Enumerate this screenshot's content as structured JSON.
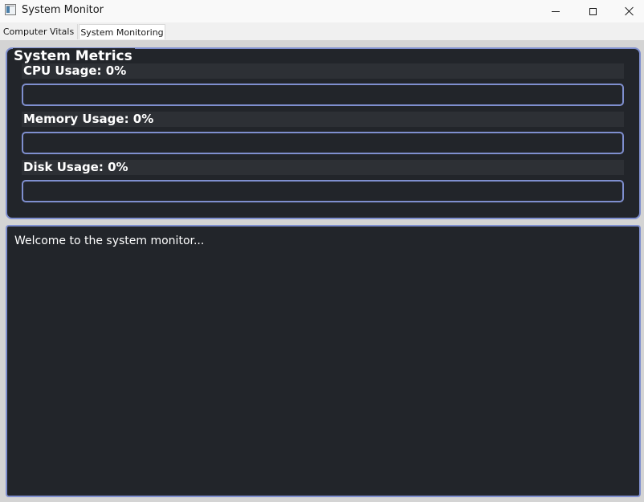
{
  "window": {
    "title": "System Monitor",
    "icon": "app-window-icon",
    "controls": {
      "minimize_icon": "minimize-icon",
      "maximize_icon": "maximize-icon",
      "close_icon": "close-icon"
    }
  },
  "tabs": [
    {
      "label": "Computer Vitals",
      "active": false
    },
    {
      "label": "System Monitoring",
      "active": true
    }
  ],
  "metrics": {
    "title": "System Metrics",
    "items": [
      {
        "label": "CPU Usage: 0%",
        "value": 0
      },
      {
        "label": "Memory Usage: 0%",
        "value": 0
      },
      {
        "label": "Disk Usage: 0%",
        "value": 0
      }
    ]
  },
  "log": {
    "text": "Welcome to the system monitor..."
  },
  "colors": {
    "panel_bg": "#22252a",
    "accent_border": "#7f8fcf",
    "label_bg": "#2d3035",
    "text": "#ffffff"
  }
}
